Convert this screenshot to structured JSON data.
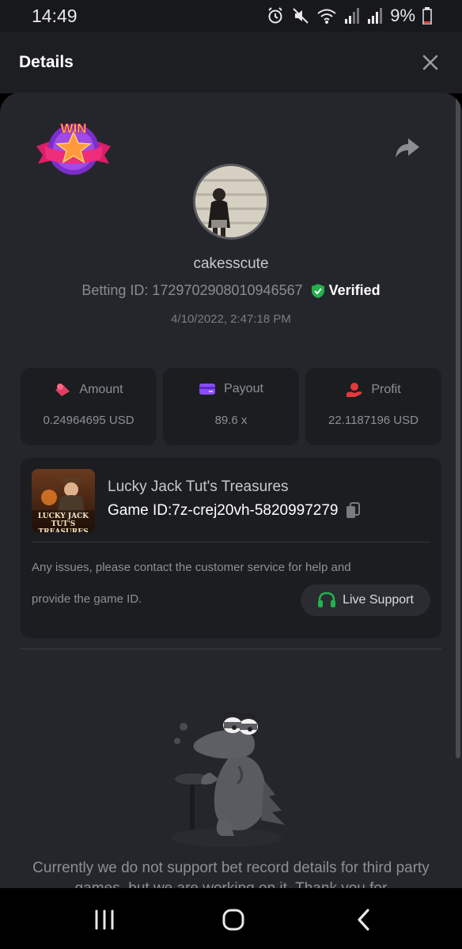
{
  "status_bar": {
    "time": "14:49",
    "battery": "9%",
    "icons": [
      "alarm-icon",
      "mute-icon",
      "wifi-icon",
      "signal-icon",
      "signal-icon",
      "battery-icon"
    ]
  },
  "header": {
    "title": "Details",
    "close_icon": "close-icon"
  },
  "bet": {
    "badge_text": "WIN",
    "username": "cakesscute",
    "betting_id": "Betting ID: 1729702908010946567",
    "verified": "Verified",
    "timestamp": "4/10/2022, 2:47:18 PM"
  },
  "stats": [
    {
      "label": "Amount",
      "value": "0.24964695 USD",
      "icon": "amount-icon",
      "color": "#e0405f"
    },
    {
      "label": "Payout",
      "value": "89.6 x",
      "icon": "payout-card-icon",
      "color": "#8a4dff"
    },
    {
      "label": "Profit",
      "value": "22.1187196 USD",
      "icon": "profit-hand-icon",
      "color": "#e43a3a"
    }
  ],
  "game": {
    "name": "Lucky Jack Tut's Treasures",
    "id": "Game ID:7z-crej20vh-5820997279",
    "thumb_text": "LUCKY JACK TUT'S TREASURES",
    "notice_line1": "Any issues, please contact the customer service for help and",
    "notice_line2": "provide the game ID.",
    "support_label": "Live Support"
  },
  "unsupported_text": "Currently we do not support bet record details for third party games, but we are working on it. Thank you for",
  "colors": {
    "accent_green": "#22b14c",
    "background": "#25262b",
    "card": "#1c1d21"
  }
}
